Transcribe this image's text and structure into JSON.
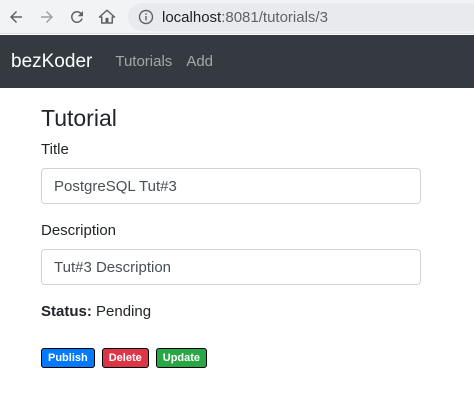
{
  "browser": {
    "url_host": "localhost",
    "url_path": ":8081/tutorials/3",
    "icons": [
      "back-arrow-icon",
      "forward-arrow-icon",
      "reload-icon",
      "home-icon",
      "info-icon"
    ]
  },
  "navbar": {
    "brand": "bezKoder",
    "links": [
      {
        "label": "Tutorials"
      },
      {
        "label": "Add"
      }
    ]
  },
  "form": {
    "heading": "Tutorial",
    "title_label": "Title",
    "title_value": "PostgreSQL Tut#3",
    "description_label": "Description",
    "description_value": "Tut#3 Description",
    "status_label": "Status:",
    "status_value": "Pending"
  },
  "actions": {
    "publish": "Publish",
    "delete": "Delete",
    "update": "Update"
  },
  "colors": {
    "navbar_bg": "#343a40",
    "publish": "#007bff",
    "delete": "#dc3545",
    "update": "#28a745"
  }
}
